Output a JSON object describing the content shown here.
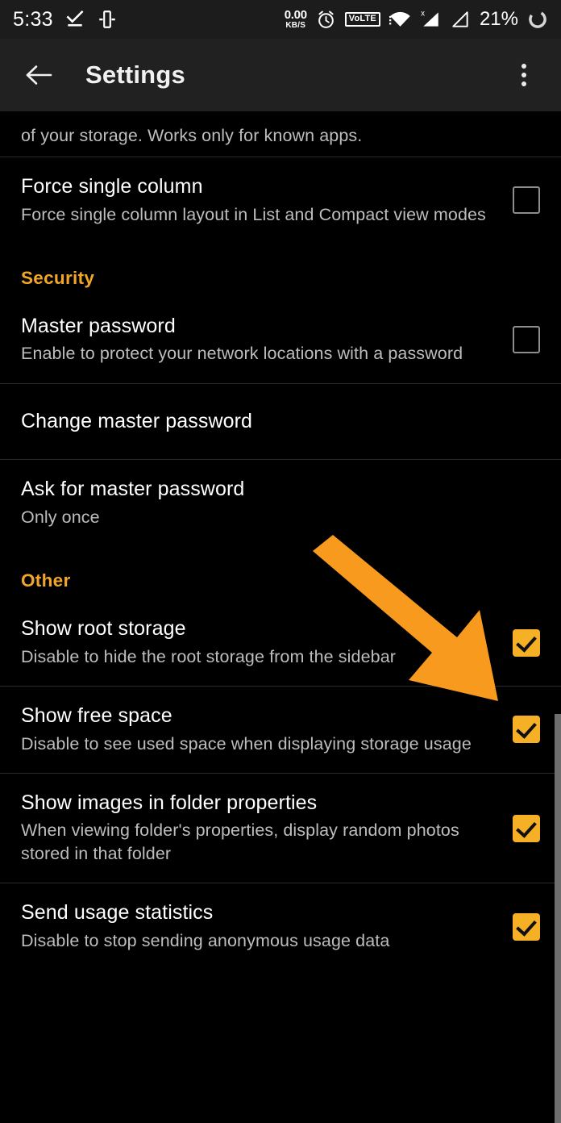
{
  "statusbar": {
    "time": "5:33",
    "icons_left": [
      "download-done-icon",
      "screen-cast-icon"
    ],
    "netspeed_value": "0.00",
    "netspeed_unit": "KB/S",
    "alarm_icon": "alarm-clock-icon",
    "volte_label": "VoLTE",
    "wifi_icon": "wifi-icon",
    "signal1_icon": "signal-no-data-icon",
    "signal2_icon": "signal-bars-icon",
    "battery_percent": "21%",
    "battery_icon": "battery-circle-icon"
  },
  "appbar": {
    "back_icon": "back-arrow-icon",
    "title": "Settings",
    "overflow_icon": "overflow-menu-icon"
  },
  "colors": {
    "accent": "#f2a628",
    "checkbox_on": "#f6b026",
    "background": "#000000",
    "appbar_background": "#212121",
    "divider": "#2a2a2a",
    "title_text": "#ffffff",
    "subtitle_text": "#bdbdbd",
    "annotation_arrow": "#f79a1e"
  },
  "list": {
    "partial_row": {
      "subtitle": "of your storage. Works only for known apps."
    },
    "items": [
      {
        "type": "setting",
        "name": "force-single-column",
        "title": "Force single column",
        "subtitle": "Force single column layout in List and Compact view modes",
        "control": "checkbox",
        "checked": false
      },
      {
        "type": "section",
        "name": "security",
        "title": "Security"
      },
      {
        "type": "setting",
        "name": "master-password",
        "title": "Master password",
        "subtitle": "Enable to protect your network locations with a password",
        "control": "checkbox",
        "checked": false
      },
      {
        "type": "setting",
        "name": "change-master-password",
        "title": "Change master password",
        "subtitle": "",
        "control": "none",
        "checked": false
      },
      {
        "type": "setting",
        "name": "ask-for-master-password",
        "title": "Ask for master password",
        "subtitle": "Only once",
        "control": "none",
        "checked": false
      },
      {
        "type": "section",
        "name": "other",
        "title": "Other"
      },
      {
        "type": "setting",
        "name": "show-root-storage",
        "title": "Show root storage",
        "subtitle": "Disable to hide the root storage from the sidebar",
        "control": "checkbox",
        "checked": true
      },
      {
        "type": "setting",
        "name": "show-free-space",
        "title": "Show free space",
        "subtitle": "Disable to see used space when displaying storage usage",
        "control": "checkbox",
        "checked": true
      },
      {
        "type": "setting",
        "name": "show-images-in-folder-properties",
        "title": "Show images in folder properties",
        "subtitle": "When viewing folder's properties, display random photos stored in that folder",
        "control": "checkbox",
        "checked": true
      },
      {
        "type": "setting",
        "name": "send-usage-statistics",
        "title": "Send usage statistics",
        "subtitle": "Disable to stop sending anonymous usage data",
        "control": "checkbox",
        "checked": true
      }
    ]
  },
  "annotation": {
    "type": "arrow",
    "name": "pointer-arrow-to-show-root-storage-checkbox",
    "points_to": "show-root-storage-checkbox"
  }
}
